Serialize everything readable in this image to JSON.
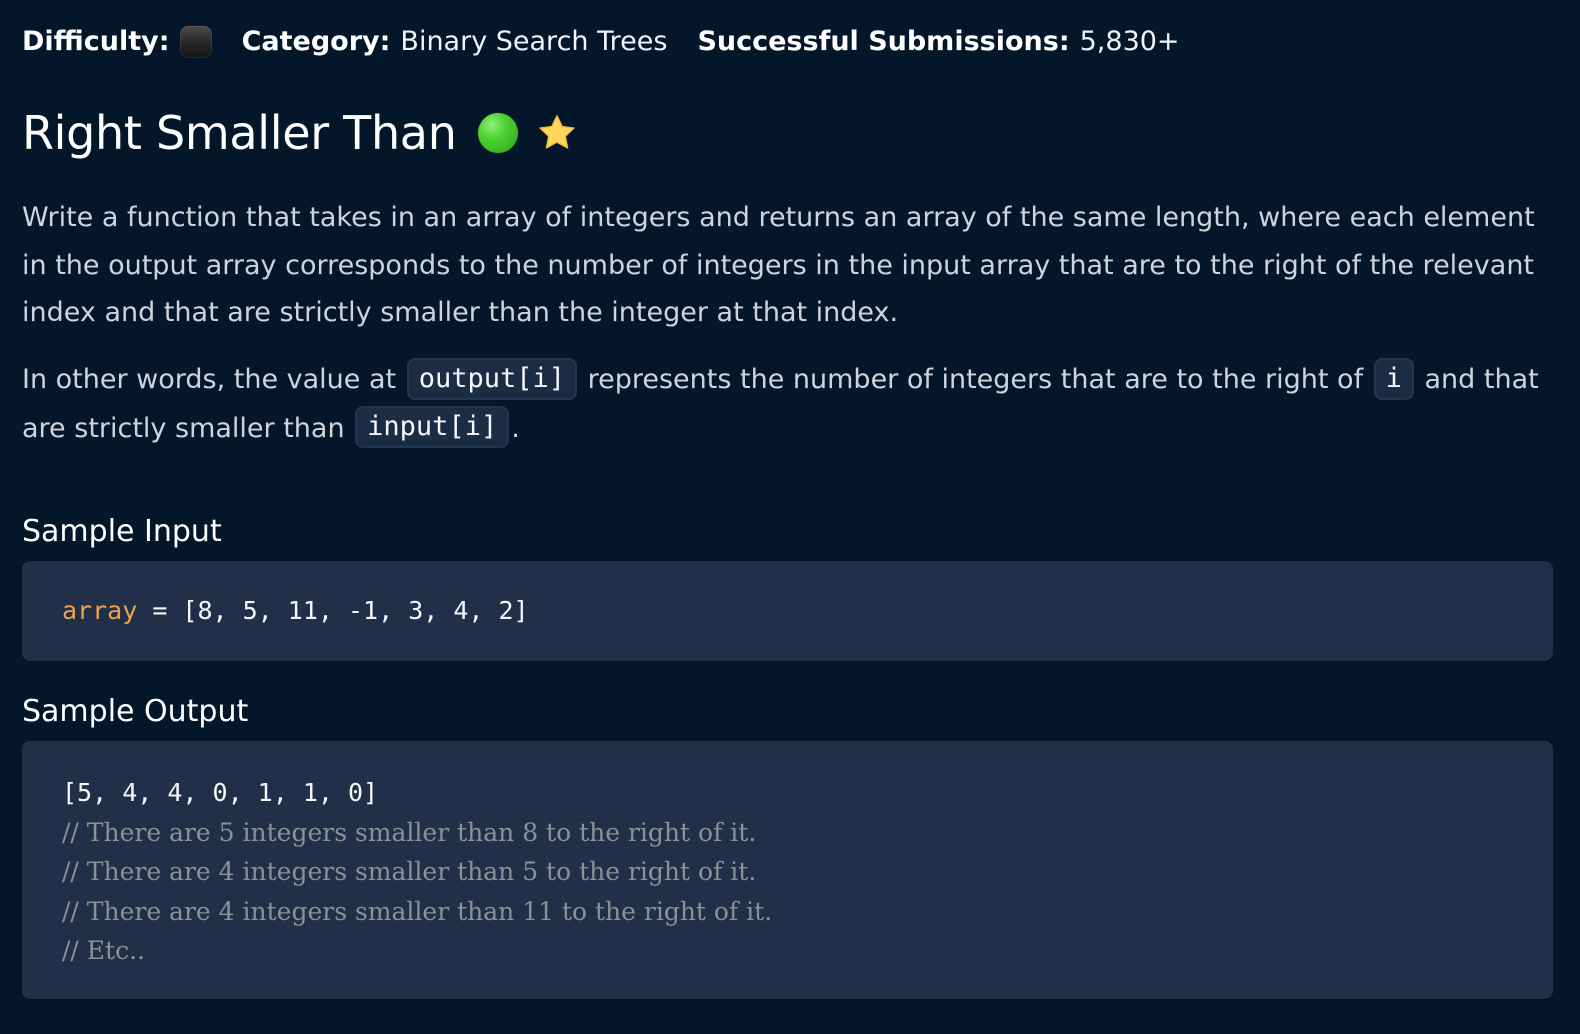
{
  "meta": {
    "difficulty_label": "Difficulty:",
    "category_label": "Category:",
    "category_value": "Binary Search Trees",
    "submissions_label": "Successful Submissions:",
    "submissions_value": "5,830+"
  },
  "problem": {
    "title": "Right Smaller Than",
    "description_p1": "Write a function that takes in an array of integers and returns an array of the same length, where each element in the output array corresponds to the number of integers in the input array that are to the right of the relevant index and that are strictly smaller than the integer at that index.",
    "description_p2": {
      "part1": "In other words, the value at ",
      "code1": "output[i]",
      "part2": " represents the number of integers that are to the right of ",
      "code2": "i",
      "part3": " and that are strictly smaller than ",
      "code3": "input[i]",
      "part4": "."
    }
  },
  "sample_input": {
    "title": "Sample Input",
    "variable": "array",
    "code": " = [8, 5, 11, -1, 3, 4, 2]"
  },
  "sample_output": {
    "title": "Sample Output",
    "lines": [
      "[5, 4, 4, 0, 1, 1, 0]",
      "// There are 5 integers smaller than 8 to the right of it.",
      "// There are 4 integers smaller than 5 to the right of it.",
      "// There are 4 integers smaller than 11 to the right of it.",
      "// Etc.."
    ]
  },
  "colors": {
    "background": "#04162a",
    "code_block": "#1f3048",
    "variable": "#f2a14c",
    "comment": "#8a9296",
    "green_status": "#4ed12f",
    "star": "#ffd65a"
  },
  "icons": {
    "difficulty": "difficulty-square-icon",
    "status": "green-dot-icon",
    "favorite": "star-icon"
  }
}
